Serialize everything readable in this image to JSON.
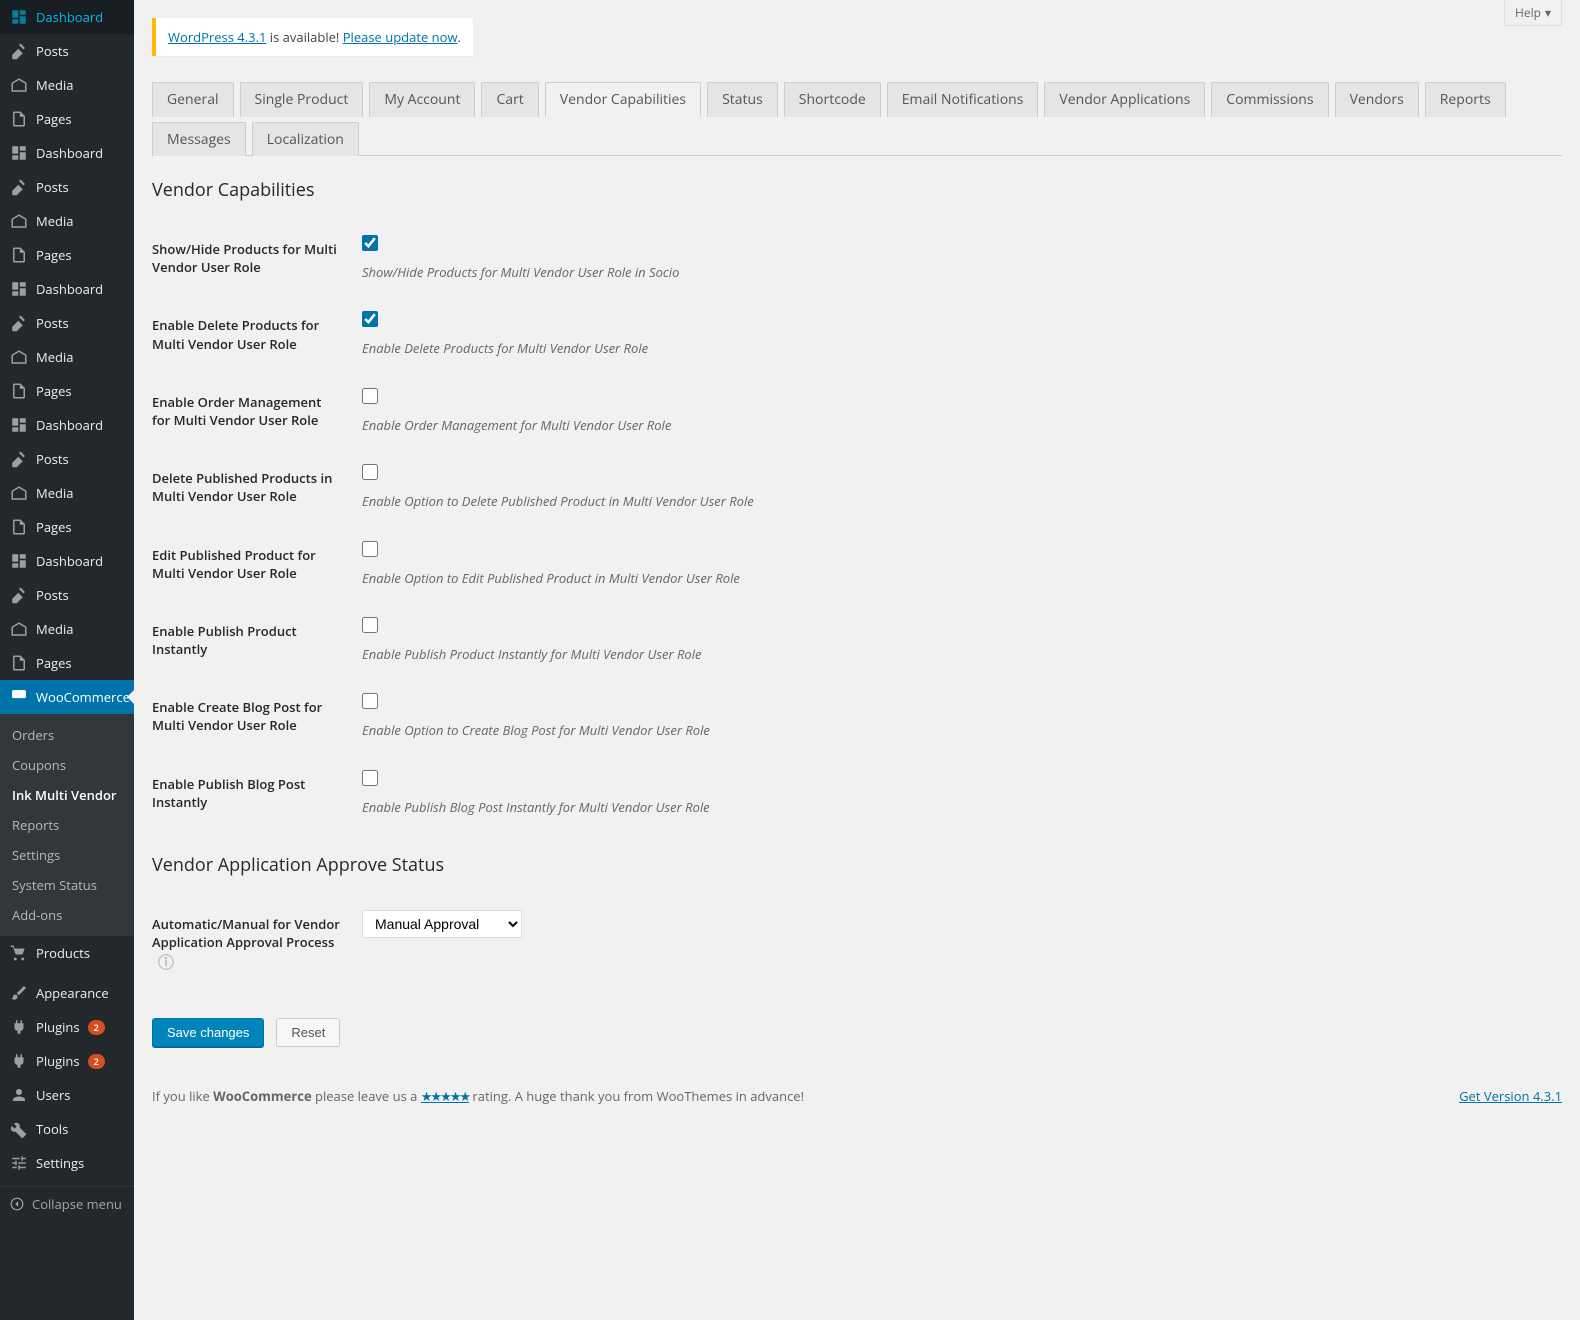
{
  "help_label": "Help",
  "notice": {
    "version_link": "WordPress 4.3.1",
    "text": " is available! ",
    "update_link": "Please update now",
    "tail": "."
  },
  "sidebar": {
    "repeats": [
      {
        "items": [
          "Dashboard",
          "Posts",
          "Media",
          "Pages"
        ]
      },
      {
        "items": [
          "Dashboard",
          "Posts",
          "Media",
          "Pages"
        ]
      },
      {
        "items": [
          "Dashboard",
          "Posts",
          "Media",
          "Pages"
        ]
      },
      {
        "items": [
          "Dashboard",
          "Posts",
          "Media",
          "Pages"
        ]
      },
      {
        "items": [
          "Dashboard",
          "Posts",
          "Media",
          "Pages"
        ]
      }
    ],
    "woocommerce": {
      "label": "WooCommerce",
      "submenu": [
        "Orders",
        "Coupons",
        "Ink Multi Vendor",
        "Reports",
        "Settings",
        "System Status",
        "Add-ons"
      ],
      "active_sub": 2
    },
    "products": "Products",
    "appearance": "Appearance",
    "plugins1": {
      "label": "Plugins",
      "badge": "2"
    },
    "plugins2": {
      "label": "Plugins",
      "badge": "2"
    },
    "users": "Users",
    "tools": "Tools",
    "settings": "Settings",
    "collapse": "Collapse menu"
  },
  "tabs": [
    "General",
    "Single Product",
    "My Account",
    "Cart",
    "Vendor Capabilities",
    "Status",
    "Shortcode",
    "Email Notifications",
    "Vendor Applications",
    "Commissions",
    "Vendors",
    "Reports",
    "Messages",
    "Localization"
  ],
  "active_tab": 4,
  "section1_title": "Vendor Capabilities",
  "fields": [
    {
      "label": "Show/Hide Products for Multi Vendor User Role",
      "checked": true,
      "desc": "Show/Hide Products for Multi Vendor User Role in Socio"
    },
    {
      "label": "Enable Delete Products for Multi Vendor User Role",
      "checked": true,
      "desc": "Enable Delete Products for Multi Vendor User Role"
    },
    {
      "label": "Enable Order Management for Multi Vendor User Role",
      "checked": false,
      "desc": "Enable Order Management for Multi Vendor User Role"
    },
    {
      "label": "Delete Published Products in Multi Vendor User Role",
      "checked": false,
      "desc": "Enable Option to Delete Published Product in Multi Vendor User Role"
    },
    {
      "label": "Edit Published Product for Multi Vendor User Role",
      "checked": false,
      "desc": "Enable Option to Edit Published Product in Multi Vendor User Role"
    },
    {
      "label": "Enable Publish Product Instantly",
      "checked": false,
      "desc": "Enable Publish Product Instantly for Multi Vendor User Role"
    },
    {
      "label": "Enable Create Blog Post for Multi Vendor User Role",
      "checked": false,
      "desc": "Enable Option to Create Blog Post for Multi Vendor User Role"
    },
    {
      "label": "Enable Publish Blog Post Instantly",
      "checked": false,
      "desc": "Enable Publish Blog Post Instantly for Multi Vendor User Role"
    }
  ],
  "section2_title": "Vendor Application Approve Status",
  "approval": {
    "label": "Automatic/Manual for Vendor Application Approval Process",
    "value": "Manual Approval"
  },
  "buttons": {
    "save": "Save changes",
    "reset": "Reset"
  },
  "footer": {
    "pre": "If you like ",
    "brand": "WooCommerce",
    "mid": " please leave us a ",
    "stars": "★★★★★",
    "post": " rating. A huge thank you from WooThemes in advance!",
    "version": "Get Version 4.3.1"
  }
}
